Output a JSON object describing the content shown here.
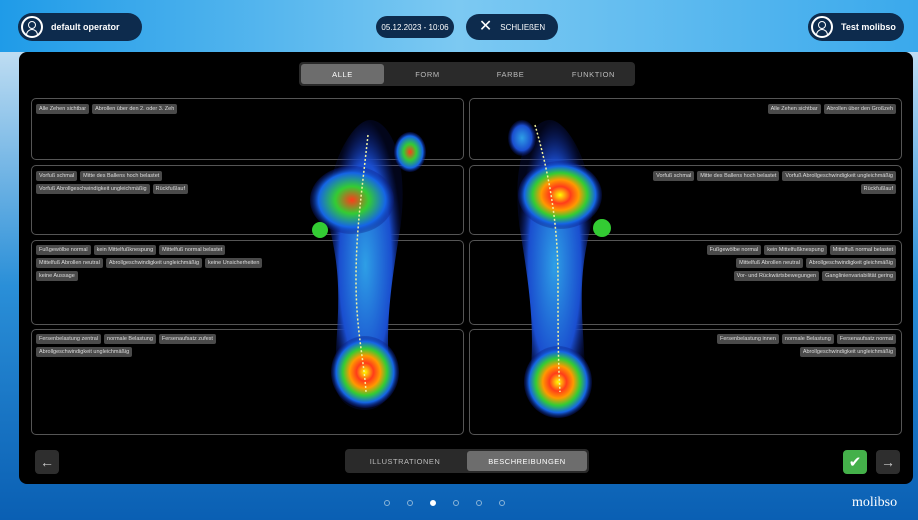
{
  "header": {
    "operator": "default operator",
    "datetime": "05.12.2023 - 10:06",
    "close_label": "SCHLIEßEN",
    "patient": "Test molibso"
  },
  "tabs": [
    "ALLE",
    "FORM",
    "FARBE",
    "FUNKTION"
  ],
  "left": {
    "toes": [
      "Alle Zehen sichtbar",
      "Abrollen über den 2. oder 3. Zeh"
    ],
    "forefoot": [
      "Vorfuß schmal",
      "Mitte des Ballens hoch belastet",
      "Vorfuß Abrollgeschwindigkeit ungleichmäßig",
      "Rückfußlauf"
    ],
    "midfoot": [
      "Fußgewölbe normal",
      "kein Mittelfußknespung",
      "Mittelfuß normal belastet",
      "Mittelfuß Abrollen neutral",
      "Abrollgeschwindigkeit ungleichmäßig",
      "keine Unsicherheiten",
      "keine Aussage"
    ],
    "heel": [
      "Fersenbelastung zentral",
      "normale Belastung",
      "Fersenaufsatz zufest",
      "Abrollgeschwindigkeit ungleichmäßig"
    ]
  },
  "right": {
    "toes": [
      "Alle Zehen sichtbar",
      "Abrollen über den Großzeh"
    ],
    "forefoot": [
      "Vorfuß schmal",
      "Mitte des Ballens hoch belastet",
      "Vorfuß Abrollgeschwindigkeit ungleichmäßig",
      "Rückfußlauf"
    ],
    "midfoot": [
      "Fußgewölbe normal",
      "kein Mittelfußknespung",
      "Mittelfuß normal belastet",
      "Mittelfuß Abrollen neutral",
      "Abrollgeschwindigkeit gleichmäßig",
      "Vor- und Rückwärtsbewegungen",
      "Ganglinienvariabilität gering"
    ],
    "heel": [
      "Fersenbelastung innen",
      "normale Belastung",
      "Fersenaufsatz normal",
      "Abrollgeschwindigkeit ungleichmäßig"
    ]
  },
  "bottom_tabs": [
    "ILLUSTRATIONEN",
    "BESCHREIBUNGEN"
  ],
  "nav": {
    "back": "←",
    "forward": "→",
    "confirm": "✔"
  },
  "brand": "molibso",
  "colors": {
    "panel": "#000000",
    "accent": "#1f9be8",
    "confirm": "#44b04a"
  }
}
